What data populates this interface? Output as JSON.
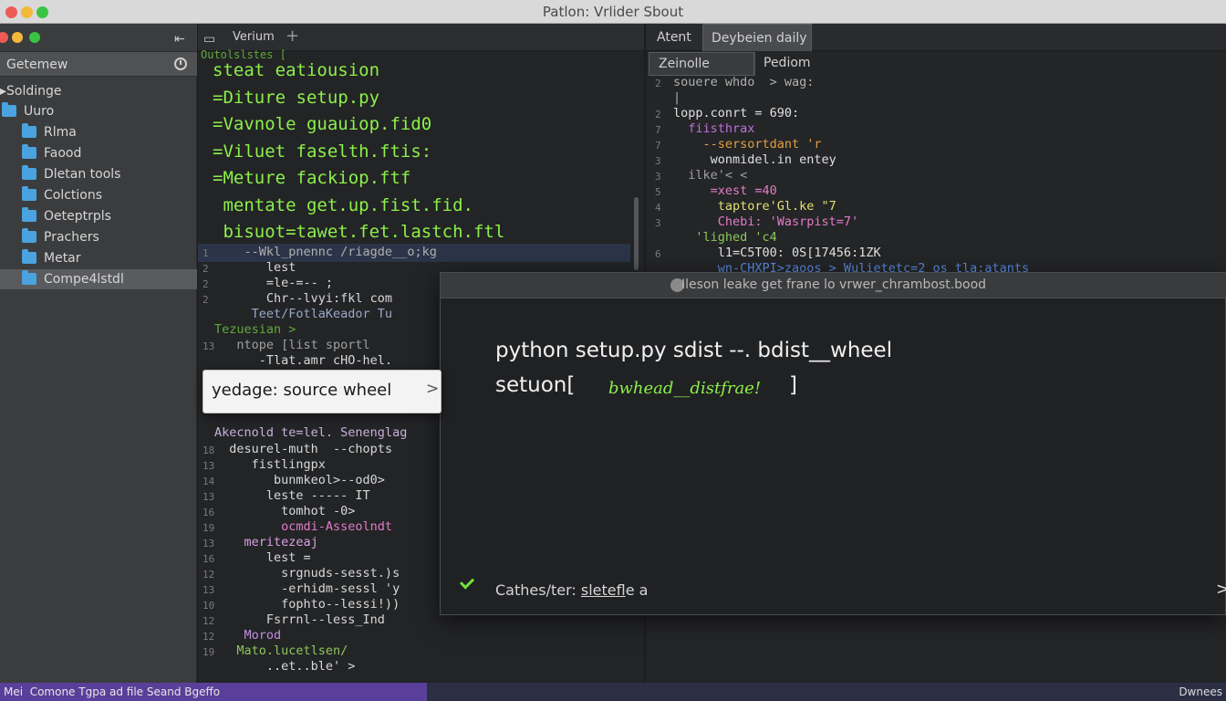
{
  "window": {
    "title": "Patlon: Vrlider Sbout"
  },
  "colors": {
    "accent_green": "#8cf04a",
    "folder_blue": "#4aa3df",
    "status_purple": "#5a3f9a"
  },
  "sidebar": {
    "header": "Getemew",
    "root": "Soldinge",
    "items": [
      {
        "label": "Uuro",
        "icon": "folder-icon",
        "selected": false
      },
      {
        "label": "Rlma",
        "icon": "folder-icon",
        "selected": false
      },
      {
        "label": "Faood",
        "icon": "folder-icon",
        "selected": false
      },
      {
        "label": "Dletan tools",
        "icon": "folder-icon",
        "selected": false
      },
      {
        "label": "Colctions",
        "icon": "folder-icon",
        "selected": false
      },
      {
        "label": "Oeteptrpls",
        "icon": "folder-icon",
        "selected": false
      },
      {
        "label": "Prachers",
        "icon": "folder-icon",
        "selected": false
      },
      {
        "label": "Metar",
        "icon": "folder-icon",
        "selected": false
      },
      {
        "label": "Compe4lstdl",
        "icon": "folder-icon",
        "selected": true
      }
    ]
  },
  "editor": {
    "tab_label": "Verium",
    "header_small": "Outolslstes [",
    "big_lines": [
      "steat eatiousion",
      "=Diture setup.py",
      "=Vavnole guauiop.fid0",
      "=Viluet faselth.ftis:",
      "=Meture fackiop.ftf",
      " mentate get.up.fist.fid.",
      " bisuot=tawet.fet.lastch.ftl"
    ],
    "code_lines": [
      {
        "num": "1",
        "text": "    --Wkl_pnennc /riagde__o;kg"
      },
      {
        "num": "2",
        "text": "       lest"
      },
      {
        "num": "2",
        "text": "       =le-=-- ;"
      },
      {
        "num": "2",
        "text": "       Chr--lvyi:fkl com"
      },
      {
        "num": "",
        "text": "     Teet/FotlaKeador Tu"
      },
      {
        "num": "",
        "text": "Tezuesian >"
      },
      {
        "num": "13",
        "text": "   ntope [list sportl"
      },
      {
        "num": "",
        "text": "      -Tlat.amr cHO-hel."
      },
      {
        "num": "",
        "text": "Akecnold te=lel. Senenglag"
      },
      {
        "num": "18",
        "text": "  desurel-muth  --chopts"
      },
      {
        "num": "13",
        "text": "     fistlingpx"
      },
      {
        "num": "14",
        "text": "        bunmkeol>--od0>"
      },
      {
        "num": "13",
        "text": "       leste ----- IT"
      },
      {
        "num": "16",
        "text": "         tomhot -0>"
      },
      {
        "num": "19",
        "text": "         ocmdi-Asseolndt"
      },
      {
        "num": "13",
        "text": "    meritezeaj"
      },
      {
        "num": "16",
        "text": "       lest ="
      },
      {
        "num": "12",
        "text": "         srgnuds-sesst.)s"
      },
      {
        "num": "13",
        "text": "         -erhidm-sessl 'y"
      },
      {
        "num": "10",
        "text": "         fophto--lessi!))"
      },
      {
        "num": "12",
        "text": "       Fsrrnl--less_Ind"
      },
      {
        "num": "12",
        "text": "    Morod"
      },
      {
        "num": "19",
        "text": "   Mato.lucetlsen/"
      },
      {
        "num": "",
        "text": "       ..et..ble' >"
      }
    ]
  },
  "right_pane": {
    "tabs": [
      "Atent",
      "Deybeien daily"
    ],
    "subtabs": [
      "Zeinolle",
      "Pediom"
    ],
    "code_lines": [
      {
        "num": "2",
        "text": "souere whdo  > wag:"
      },
      {
        "num": "",
        "text": "|"
      },
      {
        "num": "2",
        "text": "lopp.conrt = 690:"
      },
      {
        "num": "7",
        "text": "  fiisthrax"
      },
      {
        "num": "7",
        "text": "    --sersortdant 'r"
      },
      {
        "num": "3",
        "text": "     wonmidel.in entey"
      },
      {
        "num": "3",
        "text": "  ilke'< <"
      },
      {
        "num": "5",
        "text": "     =xest =40"
      },
      {
        "num": "4",
        "text": "      taptore'Gl.ke \"7"
      },
      {
        "num": "3",
        "text": "      Chebi: 'Wasrpist=7'"
      },
      {
        "num": "",
        "text": "   'lighed 'c4  "
      },
      {
        "num": "6",
        "text": "      l1=C5T00: 0S[17456:1ZK"
      },
      {
        "num": "",
        "text": "      wn-CHXPI>zaoos > Wulietetc=2 os tla:atants"
      }
    ]
  },
  "dialog": {
    "title": "Ileson leake get frane lo vrwer_chrambost.bood",
    "command_line_1": "python setup.py sdist --. bdist__wheel",
    "command_line_2_prefix": "setuon[",
    "command_line_2_highlight": "bwhead__distfrae!",
    "command_line_2_suffix": "]",
    "status_prefix": "Cathes/ter:",
    "status_link": "sletef",
    "status_suffix": "le a",
    "chevron": ">"
  },
  "tooltip": {
    "text": "yedage:  source wheel",
    "chevron": ">"
  },
  "statusbar": {
    "left": "Mei  Comone Tgpa ad file Seand Bgeffo",
    "right": "Dwnees"
  }
}
